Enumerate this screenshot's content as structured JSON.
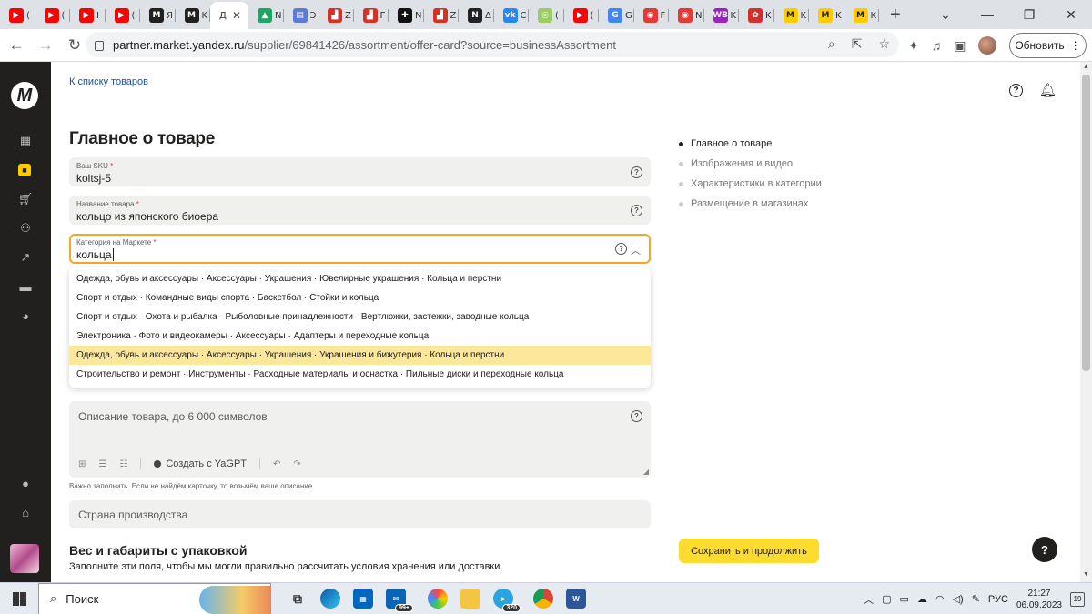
{
  "browser": {
    "tabs": [
      {
        "fav": "youtube-icon",
        "color": "#ff0000",
        "glyph": "▶",
        "label": "("
      },
      {
        "fav": "youtube-icon",
        "color": "#ff0000",
        "glyph": "▶",
        "label": "("
      },
      {
        "fav": "youtube-icon",
        "color": "#ff0000",
        "glyph": "▶",
        "label": "I"
      },
      {
        "fav": "youtube-icon",
        "color": "#ff0000",
        "glyph": "▶",
        "label": "("
      },
      {
        "fav": "market-icon",
        "color": "#21201f",
        "glyph": "M",
        "label": "Я"
      },
      {
        "fav": "market-icon",
        "color": "#21201f",
        "glyph": "M",
        "label": "K"
      },
      {
        "fav": "",
        "color": "",
        "glyph": "",
        "label": "Д",
        "active": true
      },
      {
        "fav": "drive-icon",
        "color": "#1fa463",
        "glyph": "▲",
        "label": "N"
      },
      {
        "fav": "book-icon",
        "color": "#5b7bd5",
        "glyph": "▤",
        "label": "Э"
      },
      {
        "fav": "chart-icon",
        "color": "#d93025",
        "glyph": "▟",
        "label": "Z"
      },
      {
        "fav": "chart-icon",
        "color": "#d93025",
        "glyph": "▟",
        "label": "Г"
      },
      {
        "fav": "openai-icon",
        "color": "#111111",
        "glyph": "✚",
        "label": "N"
      },
      {
        "fav": "chart-icon",
        "color": "#d93025",
        "glyph": "▟",
        "label": "Z"
      },
      {
        "fav": "notion-icon",
        "color": "#222222",
        "glyph": "N",
        "label": "Δ"
      },
      {
        "fav": "vk-icon",
        "color": "#2787f5",
        "glyph": "vk",
        "label": "C"
      },
      {
        "fav": "circle-icon",
        "color": "#9ccc65",
        "glyph": "◎",
        "label": "("
      },
      {
        "fav": "youtube-icon",
        "color": "#ff0000",
        "glyph": "▶",
        "label": "("
      },
      {
        "fav": "google-icon",
        "color": "#4285f4",
        "glyph": "G",
        "label": "G"
      },
      {
        "fav": "app-icon",
        "color": "#e53935",
        "glyph": "◉",
        "label": "F"
      },
      {
        "fav": "app-icon",
        "color": "#e53935",
        "glyph": "◉",
        "label": "N"
      },
      {
        "fav": "wb-icon",
        "color": "#a020c8",
        "glyph": "WB",
        "label": "K"
      },
      {
        "fav": "mushroom-icon",
        "color": "#d32f2f",
        "glyph": "✿",
        "label": "K"
      },
      {
        "fav": "market-yellow-icon",
        "color": "#fc0",
        "glyph": "M",
        "label": "K"
      },
      {
        "fav": "market-yellow-icon",
        "color": "#fc0",
        "glyph": "M",
        "label": "K"
      },
      {
        "fav": "market-yellow-icon",
        "color": "#fc0",
        "glyph": "M",
        "label": "K"
      }
    ],
    "url_host": "partner.market.yandex.ru",
    "url_path": "/supplier/69841426/assortment/offer-card?source=businessAssortment",
    "update_label": "Обновить"
  },
  "page": {
    "back_link": "К списку товаров",
    "title": "Главное о товаре",
    "fields": {
      "sku": {
        "label": "Ваш SKU",
        "req": "*",
        "value": "koltsj-5"
      },
      "name": {
        "label": "Название товара",
        "req": "*",
        "value": "кольцо из японского биоера"
      },
      "category": {
        "label": "Категория на Маркете",
        "req": "*",
        "value": "кольца"
      }
    },
    "dropdown": [
      "Одежда, обувь и аксессуары · Аксессуары · Украшения · Ювелирные украшения · Кольца и перстни",
      "Спорт и отдых · Командные виды спорта · Баскетбол · Стойки и кольца",
      "Спорт и отдых · Охота и рыбалка · Рыболовные принадлежности · Вертлюжки, застежки, заводные кольца",
      "Электроника · Фото и видеокамеры · Аксессуары · Адаптеры и переходные кольца",
      "Одежда, обувь и аксессуары · Аксессуары · Украшения · Украшения и бижутерия · Кольца и перстни",
      "Строительство и ремонт · Инструменты · Расходные материалы и оснастка · Пильные диски и переходные кольца"
    ],
    "highlighted_index": 4,
    "description": {
      "placeholder": "Описание товара, до 6 000 символов",
      "gpt_label": "Создать с YaGPT",
      "hint": "Важно заполнить. Если не найдём карточку, то возьмём ваше описание"
    },
    "country_placeholder": "Страна производства",
    "section2_title": "Вес и габариты с упаковкой",
    "section2_text": "Заполните эти поля, чтобы мы могли правильно рассчитать условия хранения или доставки.",
    "toc": [
      {
        "label": "Главное о товаре",
        "current": true
      },
      {
        "label": "Изображения и видео",
        "current": false
      },
      {
        "label": "Характеристики в категории",
        "current": false
      },
      {
        "label": "Размещение в магазинах",
        "current": false
      }
    ],
    "save_label": "Сохранить и продолжить",
    "help_fab": "?"
  },
  "taskbar": {
    "search_label": "Поиск",
    "mail_badge": "99+",
    "telegram_badge": "320",
    "lang": "РУС",
    "time": "21:27",
    "date": "06.09.2023",
    "notifications": "19"
  }
}
